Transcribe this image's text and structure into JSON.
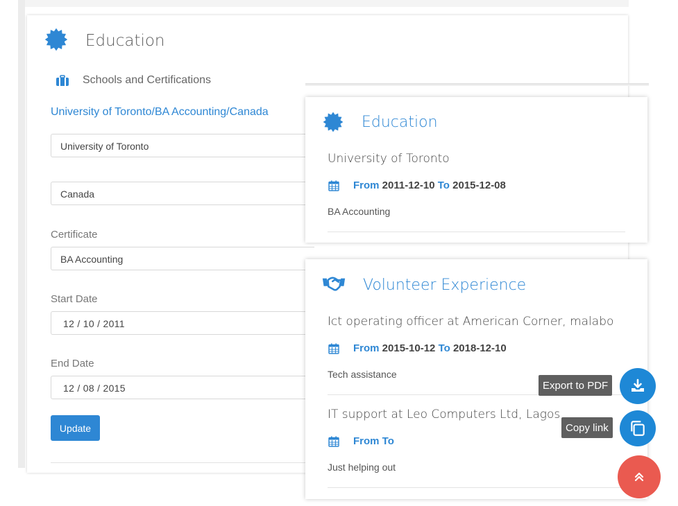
{
  "editor": {
    "title": "Education",
    "subtitle": "Schools and Certifications",
    "entry_link": "University of Toronto/BA Accounting/Canada",
    "school_value": "University of Toronto",
    "country_value": "Canada",
    "certificate_label": "Certificate",
    "certificate_value": "BA Accounting",
    "start_label": "Start Date",
    "start_value": "12 / 10 / 2011",
    "end_label": "End Date",
    "end_value": "12 / 08 / 2015",
    "update_label": "Update"
  },
  "preview_education": {
    "title": "Education",
    "item": {
      "title": "University of Toronto",
      "from_label": "From",
      "from_value": "2011-12-10",
      "to_label": "To",
      "to_value": "2015-12-08",
      "description": "BA Accounting"
    }
  },
  "preview_volunteer": {
    "title": "Volunteer Experience",
    "items": [
      {
        "title": "Ict operating officer at American Corner, malabo",
        "from_label": "From",
        "from_value": "2015-10-12",
        "to_label": "To",
        "to_value": "2018-12-10",
        "description": "Tech assistance"
      },
      {
        "title": "IT support at Leo Computers Ltd, Lagos",
        "from_label": "From",
        "to_label": "To",
        "description": "Just helping out"
      }
    ]
  },
  "actions": {
    "export_pdf_tooltip": "Export to PDF",
    "copy_link_tooltip": "Copy link"
  },
  "icons": {
    "badge": "certificate-badge-icon",
    "briefcase": "briefcase-icon",
    "calendar": "calendar-icon",
    "handshake": "handshake-icon",
    "download": "download-icon",
    "copy": "copy-icon",
    "scroll_top": "double-chevron-up-icon"
  },
  "colors": {
    "accent": "#2e87d4",
    "fab_blue": "#1e88d6",
    "fab_red": "#ea5a50",
    "tooltip_bg": "#5f5f5f"
  }
}
